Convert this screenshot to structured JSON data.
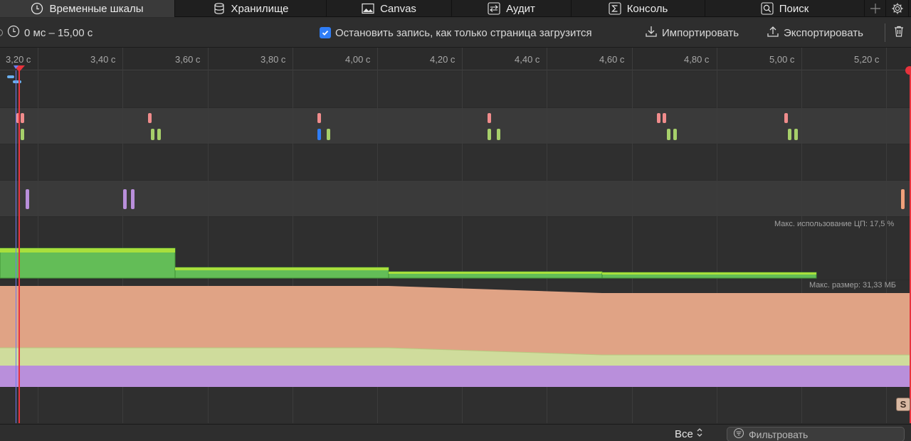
{
  "tabs": [
    {
      "label": "Временные шкалы",
      "icon": "clock-icon",
      "active": true
    },
    {
      "label": "Хранилище",
      "icon": "database-icon"
    },
    {
      "label": "Canvas",
      "icon": "image-icon"
    },
    {
      "label": "Аудит",
      "icon": "audit-arrows-icon"
    },
    {
      "label": "Консоль",
      "icon": "console-sigma-icon"
    },
    {
      "label": "Поиск",
      "icon": "search-icon"
    }
  ],
  "toolbar": {
    "range": "0 мс – 15,00 с",
    "stop_recording_label": "Остановить запись, как только страница загрузится",
    "stop_recording_checked": true,
    "import_label": "Импортировать",
    "export_label": "Экспортировать"
  },
  "ruler": {
    "ticks": [
      "3,20 с",
      "3,40 с",
      "3,60 с",
      "3,80 с",
      "4,00 с",
      "4,20 с",
      "4,40 с",
      "4,60 с",
      "4,80 с",
      "5,00 с",
      "5,20 с"
    ]
  },
  "tracks": {
    "cpu_caption": "Макс. использование ЦП: 17,5 %",
    "memory_caption": "Макс. размер: 31,33 МБ"
  },
  "badge": "S",
  "bottombar": {
    "scope_label": "Все",
    "filter_placeholder": "Фильтровать"
  },
  "colors": {
    "accent_blue": "#2f7df6",
    "playhead_red": "#e8323c",
    "cpu_green": "#63bd57",
    "memory_salmon": "#e0a385",
    "memory_light_green": "#cfdc9c",
    "memory_purple": "#b98fdb"
  }
}
